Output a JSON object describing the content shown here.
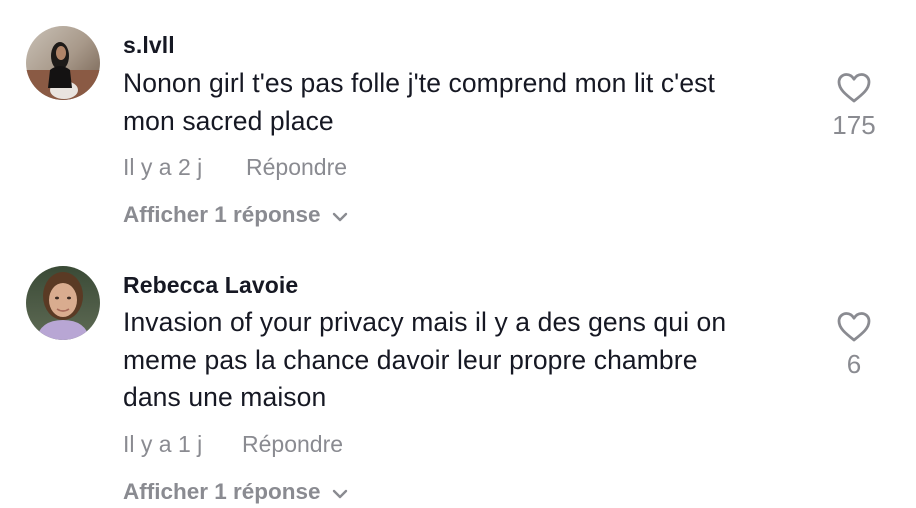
{
  "comments": [
    {
      "username": "s.lvll",
      "text_lines": [
        "Nonon girl t'es pas folle j'te comprend mon lit c'est",
        "mon sacred place"
      ],
      "time": "Il y a 2 j",
      "reply_label": "Répondre",
      "view_replies_label": "Afficher 1 réponse",
      "like_count": "175",
      "avatar_icon": "user-avatar-photo"
    },
    {
      "username": "Rebecca Lavoie",
      "text_lines": [
        "Invasion of your privacy mais il y a des gens qui on",
        "meme pas la chance davoir leur propre chambre",
        "dans une maison"
      ],
      "time": "Il y a 1 j",
      "reply_label": "Répondre",
      "view_replies_label": "Afficher 1 réponse",
      "like_count": "6",
      "avatar_icon": "user-avatar-photo"
    }
  ],
  "colors": {
    "text_primary": "#161823",
    "text_secondary": "#8a8b91",
    "heart_outline": "#8a8b91"
  },
  "icons": {
    "like": "heart-outline-icon",
    "expand": "chevron-down-icon"
  }
}
